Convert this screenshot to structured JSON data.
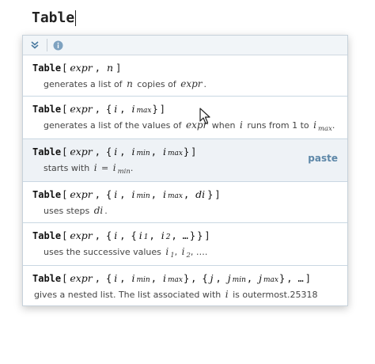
{
  "input": {
    "text": "Table"
  },
  "toolbar": {
    "icons": [
      "double-chevron-down-icon",
      "info-icon"
    ]
  },
  "entries": [
    {
      "fn": "Table",
      "desc_parts": [
        "generates a list of ",
        " copies of ",
        "."
      ],
      "vars": {
        "n": "n",
        "expr": "expr"
      }
    },
    {
      "fn": "Table",
      "desc_parts": [
        "generates a list of the values of ",
        " when ",
        " runs from 1 to ",
        "."
      ],
      "vars": {
        "expr": "expr",
        "i": "i",
        "imax": "i",
        "max": "max"
      }
    },
    {
      "fn": "Table",
      "desc_parts": [
        "starts with ",
        " = ",
        "."
      ],
      "vars": {
        "i": "i",
        "imin": "i",
        "min": "min"
      },
      "paste_label": "paste"
    },
    {
      "fn": "Table",
      "desc_parts": [
        "uses steps ",
        "."
      ],
      "vars": {
        "di": "di"
      }
    },
    {
      "fn": "Table",
      "desc_parts": [
        "uses the successive values ",
        ", ",
        ", …."
      ],
      "vars": {
        "i1": "i",
        "s1": "1",
        "i2": "i",
        "s2": "2"
      }
    },
    {
      "fn": "Table",
      "desc_parts": [
        "gives a nested list. The list associated with ",
        " is outermost.25318"
      ],
      "vars": {
        "i": "i",
        "j": "j",
        "jmin": "j",
        "jmax": "j"
      }
    }
  ],
  "sig_tokens": {
    "expr": "expr",
    "n": "n",
    "i": "i",
    "di": "di",
    "j": "j",
    "min": "min",
    "max": "max",
    "one": "1",
    "two": "2",
    "ellipsis": "…"
  },
  "colors": {
    "accent": "#5d87a8",
    "selected_bg": "#eef2f6",
    "separator": "#c9d7e2"
  }
}
